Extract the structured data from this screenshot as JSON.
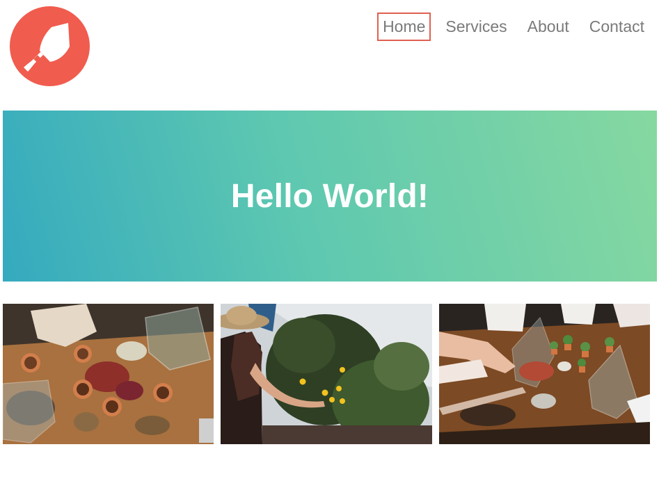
{
  "brand": {
    "logo_icon": "trowel-icon",
    "logo_color": "#f05c4e"
  },
  "nav": {
    "items": [
      {
        "label": "Home",
        "active": true
      },
      {
        "label": "Services",
        "active": false
      },
      {
        "label": "About",
        "active": false
      },
      {
        "label": "Contact",
        "active": false
      }
    ],
    "active_border_color": "#e0604f",
    "text_color": "#7a7a7a"
  },
  "hero": {
    "title": "Hello World!",
    "gradient_start": "#35aabf",
    "gradient_end": "#86d8a0"
  },
  "gallery": {
    "images": [
      {
        "name": "photo-soil-pots-table"
      },
      {
        "name": "photo-woman-picking-citrus"
      },
      {
        "name": "photo-terrarium-workshop"
      }
    ]
  }
}
